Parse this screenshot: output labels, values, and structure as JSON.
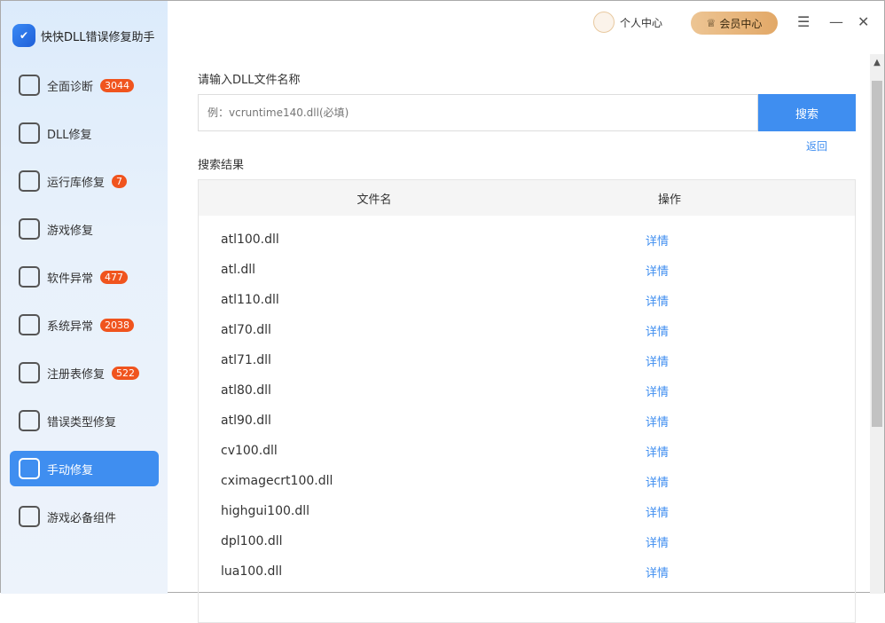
{
  "app": {
    "title": "快快DLL错误修复助手"
  },
  "sidebar": {
    "items": [
      {
        "label": "全面诊断",
        "badge": "3044",
        "icon": "target-icon"
      },
      {
        "label": "DLL修复",
        "icon": "dll-icon"
      },
      {
        "label": "运行库修复",
        "badge": "7",
        "icon": "code-window-icon"
      },
      {
        "label": "游戏修复",
        "icon": "gamepad-icon"
      },
      {
        "label": "软件异常",
        "badge": "477",
        "icon": "warning-monitor-icon"
      },
      {
        "label": "系统异常",
        "badge": "2038",
        "icon": "gear-window-icon"
      },
      {
        "label": "注册表修复",
        "badge": "522",
        "icon": "list-icon"
      },
      {
        "label": "错误类型修复",
        "icon": "error-window-icon"
      },
      {
        "label": "手动修复",
        "icon": "hand-pointer-icon"
      },
      {
        "label": "游戏必备组件",
        "icon": "grid-icon"
      }
    ]
  },
  "header": {
    "user": "个人中心",
    "vip": "会员中心"
  },
  "main": {
    "input_label": "请输入DLL文件名称",
    "placeholder": "例：vcruntime140.dll(必填)",
    "search": "搜索",
    "back": "返回",
    "results_label": "搜索结果",
    "columns": [
      "文件名",
      "操作"
    ],
    "rows": [
      "atl100.dll",
      "atl.dll",
      "atl110.dll",
      "atl70.dll",
      "atl71.dll",
      "atl80.dll",
      "atl90.dll",
      "cv100.dll",
      "cximagecrt100.dll",
      "highgui100.dll",
      "dpl100.dll",
      "lua100.dll"
    ],
    "detail": "详情"
  }
}
